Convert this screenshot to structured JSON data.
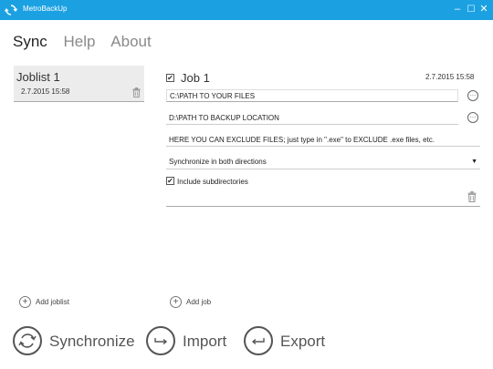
{
  "window": {
    "title": "MetroBackUp",
    "controls": [
      "minimize",
      "maximize",
      "close"
    ]
  },
  "nav": {
    "tabs": [
      "Sync",
      "Help",
      "About"
    ],
    "active": "Sync"
  },
  "joblists": [
    {
      "name": "Joblist 1",
      "date": "2.7.2015 15:58"
    }
  ],
  "job": {
    "title": "Job 1",
    "checked": true,
    "date": "2.7.2015 15:58",
    "source": "C:\\PATH TO YOUR FILES",
    "destination": "D:\\PATH TO BACKUP LOCATION",
    "exclude": "HERE YOU CAN EXCLUDE FILES; just type in \".exe\" to EXCLUDE .exe files, etc.",
    "direction": "Synchronize in both directions",
    "include_subdirectories_label": "Include subdirectories",
    "include_subdirectories": true
  },
  "actions": {
    "add_joblist": "Add joblist",
    "add_job": "Add job",
    "synchronize": "Synchronize",
    "import": "Import",
    "export": "Export"
  },
  "colors": {
    "titlebar": "#1ba1e2"
  }
}
